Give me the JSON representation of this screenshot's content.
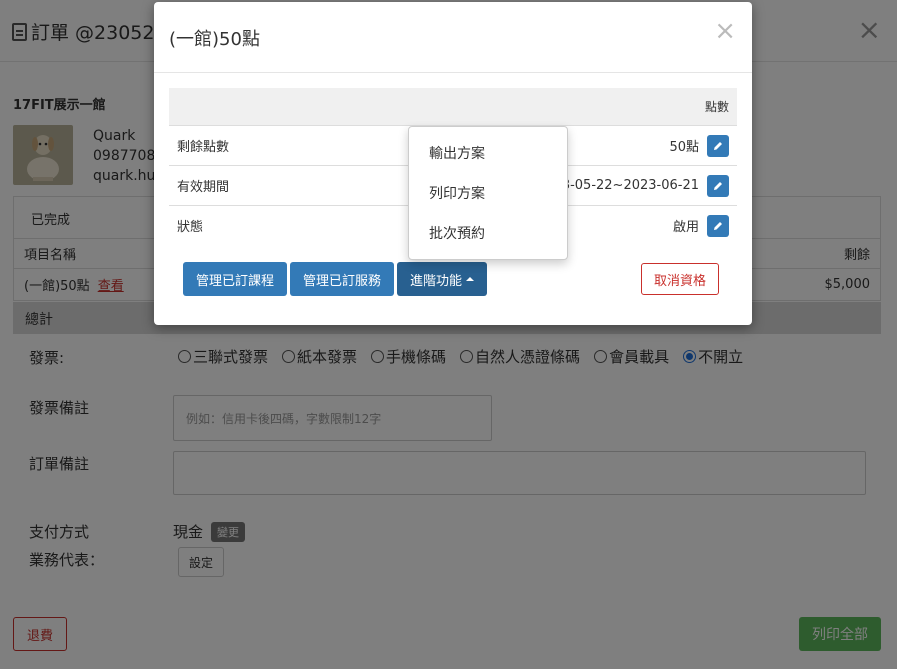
{
  "background": {
    "title": "訂單 @2305220",
    "store_name": "17FIT展示一館",
    "user": {
      "name": "Quark",
      "phone": "09877085",
      "email": "quark.hua"
    },
    "order_status": "已完成",
    "table_headers": {
      "item_name": "項目名稱",
      "remaining": "剩餘"
    },
    "table_row": {
      "name": "(一館)50點",
      "link": "查看",
      "amount": "$5,000"
    },
    "total_label": "總計",
    "invoice_label": "發票:",
    "invoice_options": [
      "三聯式發票",
      "紙本發票",
      "手機條碼",
      "自然人憑證條碼",
      "會員載具",
      "不開立"
    ],
    "invoice_selected": "不開立",
    "invoice_note_label": "發票備註",
    "invoice_note_placeholder": "例如：信用卡後四碼，字數限制12字",
    "order_note_label": "訂單備註",
    "payment_label": "支付方式",
    "payment_value": "現金",
    "payment_change": "變更",
    "sales_rep_label": "業務代表：",
    "sales_rep_button": "設定",
    "refund_button": "退費",
    "print_all_button": "列印全部"
  },
  "modal": {
    "title": "(一館)50點",
    "table_header": "點數",
    "rows": [
      {
        "label": "剩餘點數",
        "value": "50點"
      },
      {
        "label": "有效期間",
        "value": "2023-05-22~2023-06-21"
      },
      {
        "label": "狀態",
        "value": "啟用"
      }
    ],
    "buttons": {
      "manage_courses": "管理已訂課程",
      "manage_services": "管理已訂服務",
      "advanced": "進階功能",
      "cancel_eligibility": "取消資格"
    },
    "dropdown_items": [
      "輸出方案",
      "列印方案",
      "批次預約"
    ]
  },
  "colors": {
    "primary": "#337ab7",
    "danger": "#c9302c",
    "success": "#5cb85c"
  }
}
